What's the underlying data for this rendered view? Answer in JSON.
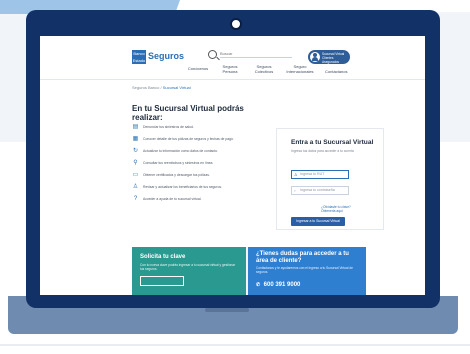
{
  "header": {
    "brand_box": "Banco Estado",
    "brand_name": "Seguros",
    "search_placeholder": "Buscar",
    "nav": [
      {
        "label": "Conócenos"
      },
      {
        "label": "Seguros Persona"
      },
      {
        "label": "Seguros Colectivos"
      },
      {
        "label": "Seguro Internacionales"
      }
    ],
    "access_label": "Sucursal Virtual Clientes Asegurados",
    "contact_label": "Contáctanos"
  },
  "breadcrumb": {
    "home": "Seguros Banco",
    "separator": "/",
    "current": "Sucursal Virtual"
  },
  "left": {
    "title": "En tu Sucursal Virtual podrás realizar:",
    "features": [
      {
        "icon": "document-icon",
        "glyph": "▤",
        "text": "Denunciar tus siniestros de salud."
      },
      {
        "icon": "calendar-icon",
        "glyph": "▦",
        "text": "Conocer detalle de tus pólizas de seguros y fechas de pago."
      },
      {
        "icon": "refresh-icon",
        "glyph": "↻",
        "text": "Actualizar tu información como datos de contacto."
      },
      {
        "icon": "search-icon",
        "glyph": "⚲",
        "text": "Consultar tus reembolsos y siniestros en línea."
      },
      {
        "icon": "certificate-icon",
        "glyph": "▭",
        "text": "Obtener certificados y descargar tus pólizas."
      },
      {
        "icon": "person-icon",
        "glyph": "♙",
        "text": "Revisar y actualizar los beneficiarios de tus seguros."
      },
      {
        "icon": "help-icon",
        "glyph": "?",
        "text": "Acceder a ayuda de tu sucursal virtual."
      }
    ]
  },
  "login": {
    "title": "Entra a tu Sucursal Virtual",
    "subtitle": "Ingresa tus datos para acceder a tu cuenta",
    "user_placeholder": "Ingresa tu RUT",
    "pass_placeholder": "Ingresa tu contraseña",
    "forgot_link": "¿Olvidaste tu clave? Obtenerla aquí",
    "submit_label": "Ingresar a tu Sucursal Virtual"
  },
  "bottom": {
    "green_title": "Solicita tu clave",
    "green_text": "Con tu nueva clave podrás ingresar a tu sucursal virtual y gestionar tus seguros.",
    "blue_title": "¿Tienes dudas para acceder a tu área de cliente?",
    "blue_text": "Contáctanos y te ayudaremos con el ingreso a tu Sucursal Virtual de seguros.",
    "phone": "600 391 9000"
  },
  "colors": {
    "bezel": "#123166",
    "accent": "#2a6fb6",
    "green_panel": "#2a9a91",
    "blue_panel": "#2f7fd1"
  }
}
